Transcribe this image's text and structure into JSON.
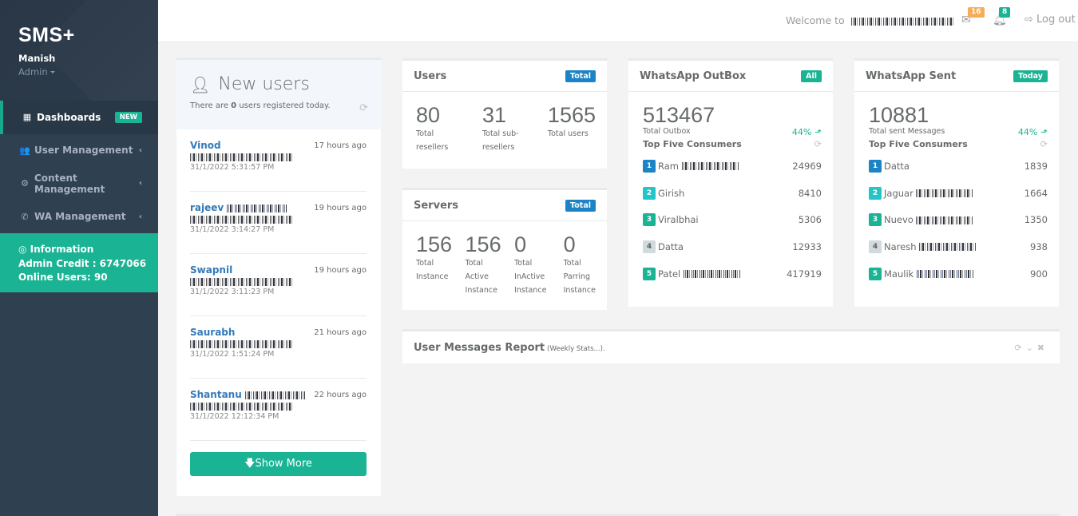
{
  "sidebar": {
    "brand": "SMS+",
    "user_name": "Manish",
    "user_role": "Admin",
    "nav": [
      {
        "label": "Dashboards",
        "icon": "th-large-icon",
        "badge": "NEW",
        "active": true
      },
      {
        "label": "User Management",
        "icon": "users-icon"
      },
      {
        "label": "Content Management",
        "icon": "cogs-icon"
      },
      {
        "label": "WA Management",
        "icon": "whatsapp-icon"
      }
    ],
    "info": {
      "title": "Information",
      "credit": "Admin Credit : 6747066",
      "online": "Online Users: 90"
    }
  },
  "topbar": {
    "welcome": "Welcome to",
    "mail_count": "16",
    "bell_count": "8",
    "logout": "Log out"
  },
  "new_users": {
    "title": "New users",
    "sub_pre": "There are ",
    "sub_count": "0",
    "sub_post": " users registered today.",
    "items": [
      {
        "name": "Vinod",
        "ago": "17 hours ago",
        "date": "31/1/2022 5:31:57 PM"
      },
      {
        "name": "rajeev",
        "ago": "19 hours ago",
        "date": "31/1/2022 3:14:27 PM"
      },
      {
        "name": "Swapnil",
        "ago": "19 hours ago",
        "date": "31/1/2022 3:11:23 PM"
      },
      {
        "name": "Saurabh",
        "ago": "21 hours ago",
        "date": "31/1/2022 1:51:24 PM"
      },
      {
        "name": "Shantanu",
        "ago": "22 hours ago",
        "date": "31/1/2022 12:12:34 PM"
      }
    ],
    "show_more": "Show More"
  },
  "users_panel": {
    "title": "Users",
    "tag": "Total",
    "stats": [
      {
        "value": "80",
        "label1": "Total",
        "label2": "resellers"
      },
      {
        "value": "31",
        "label1": "Total sub-",
        "label2": "resellers"
      },
      {
        "value": "1565",
        "label1": "Total users",
        "label2": ""
      }
    ]
  },
  "servers_panel": {
    "title": "Servers",
    "tag": "Total",
    "stats": [
      {
        "value": "156",
        "label1": "Total",
        "label2": "Instance",
        "label3": ""
      },
      {
        "value": "156",
        "label1": "Total",
        "label2": "Active",
        "label3": "Instance"
      },
      {
        "value": "0",
        "label1": "Total",
        "label2": "InActive",
        "label3": "Instance"
      },
      {
        "value": "0",
        "label1": "Total",
        "label2": "Parring",
        "label3": "Instance"
      }
    ]
  },
  "outbox_panel": {
    "title": "WhatsApp OutBox",
    "tag": "All",
    "value": "513467",
    "label": "Total Outbox",
    "pct": "44%",
    "top_title": "Top Five Consumers",
    "consumers": [
      {
        "rank": "1",
        "name": "Ram",
        "value": "24969"
      },
      {
        "rank": "2",
        "name": "Girish",
        "value": "8410"
      },
      {
        "rank": "3",
        "name": "Viralbhai",
        "value": "5306"
      },
      {
        "rank": "4",
        "name": "Datta",
        "value": "12933"
      },
      {
        "rank": "5",
        "name": "Patel",
        "value": "417919"
      }
    ]
  },
  "sent_panel": {
    "title": "WhatsApp Sent",
    "tag": "Today",
    "value": "10881",
    "label": "Total sent Messages",
    "pct": "44%",
    "top_title": "Top Five Consumers",
    "consumers": [
      {
        "rank": "1",
        "name": "Datta",
        "value": "1839"
      },
      {
        "rank": "2",
        "name": "Jaguar",
        "value": "1664"
      },
      {
        "rank": "3",
        "name": "Nuevo",
        "value": "1350"
      },
      {
        "rank": "4",
        "name": "Naresh",
        "value": "938"
      },
      {
        "rank": "5",
        "name": "Maulik",
        "value": "900"
      }
    ]
  },
  "report": {
    "title": "User Messages Report",
    "subtitle": "(Weekly Stats...)."
  }
}
